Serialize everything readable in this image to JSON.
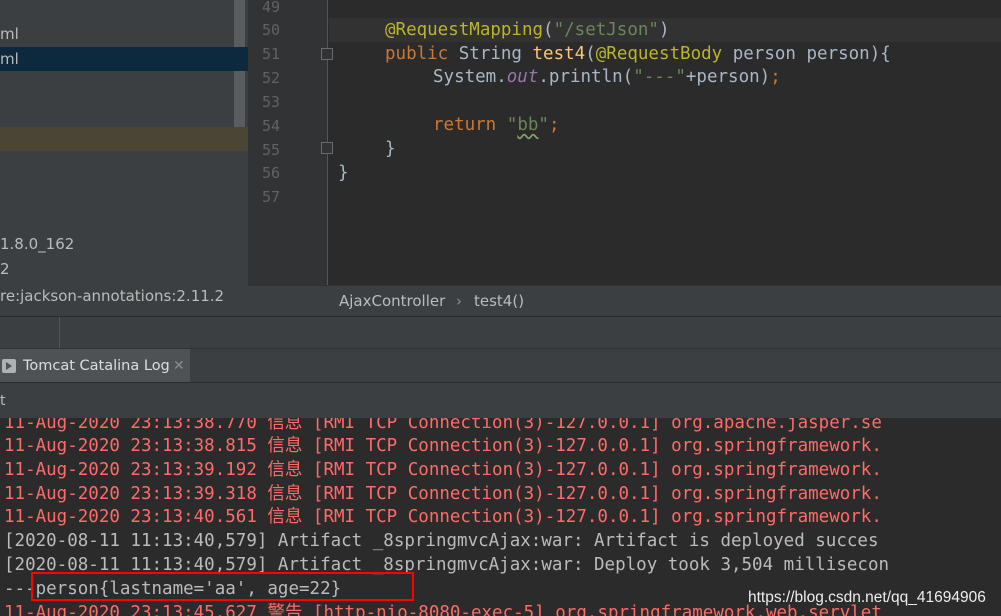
{
  "project_tree": {
    "rows": [
      {
        "label": "ml"
      },
      {
        "label": "ml"
      },
      {
        "label": "1.8.0_162"
      },
      {
        "label": "2"
      },
      {
        "label": "re:jackson-annotations:2.11.2"
      }
    ]
  },
  "editor": {
    "line_numbers": [
      "49",
      "50",
      "51",
      "52",
      "53",
      "54",
      "55",
      "56",
      "57"
    ],
    "code": {
      "l50": {
        "annotation": "@RequestMapping",
        "open": "(",
        "string": "\"/setJson\"",
        "close": ")"
      },
      "l51": {
        "kw": "public",
        "type": " String ",
        "method": "test4",
        "open": "(",
        "annotation": "@RequestBody",
        "params": " person person){"
      },
      "l52": {
        "prefix": "System.",
        "field": "out",
        "call": ".println(",
        "string": "\"---\"",
        "rest": "+person)",
        "semi": ";"
      },
      "l54": {
        "kw": "return",
        "sp": " ",
        "q1": "\"",
        "str": "bb",
        "q2": "\"",
        "semi": ";"
      },
      "l55": {
        "text": "}"
      },
      "l56": {
        "text": "}"
      }
    }
  },
  "breadcrumb": {
    "items": [
      "AjaxController",
      "›",
      "test4()"
    ]
  },
  "tool_window": {
    "tab_label": "Tomcat Catalina Log",
    "close_symbol": "✕",
    "sub_label": "t"
  },
  "console": {
    "lines": [
      "11-Aug-2020 23:13:38.770 信息 [RMI TCP Connection(3)-127.0.0.1] org.apache.jasper.se",
      "11-Aug-2020 23:13:38.815 信息 [RMI TCP Connection(3)-127.0.0.1] org.springframework.",
      "11-Aug-2020 23:13:39.192 信息 [RMI TCP Connection(3)-127.0.0.1] org.springframework.",
      "11-Aug-2020 23:13:39.318 信息 [RMI TCP Connection(3)-127.0.0.1] org.springframework.",
      "11-Aug-2020 23:13:40.561 信息 [RMI TCP Connection(3)-127.0.0.1] org.springframework.",
      "[2020-08-11 11:13:40,579] Artifact _8springmvcAjax:war: Artifact is deployed succes",
      "[2020-08-11 11:13:40,579] Artifact _8springmvcAjax:war: Deploy took 3,504 millisecon",
      "---person{lastname='aa', age=22}",
      "11-Aug-2020 23:13:45.627 警告 [http-nio-8080-exec-5] org.springframework.web.servlet"
    ],
    "watermark": "https://blog.csdn.net/qq_41694906"
  },
  "colors": {
    "bg": "#2b2b2b",
    "panel": "#3c3f41",
    "error_red": "#ff6b68",
    "highlight_box": "#ff0000",
    "annotation": "#bbb529",
    "string": "#6a8759",
    "keyword": "#cc7832"
  }
}
